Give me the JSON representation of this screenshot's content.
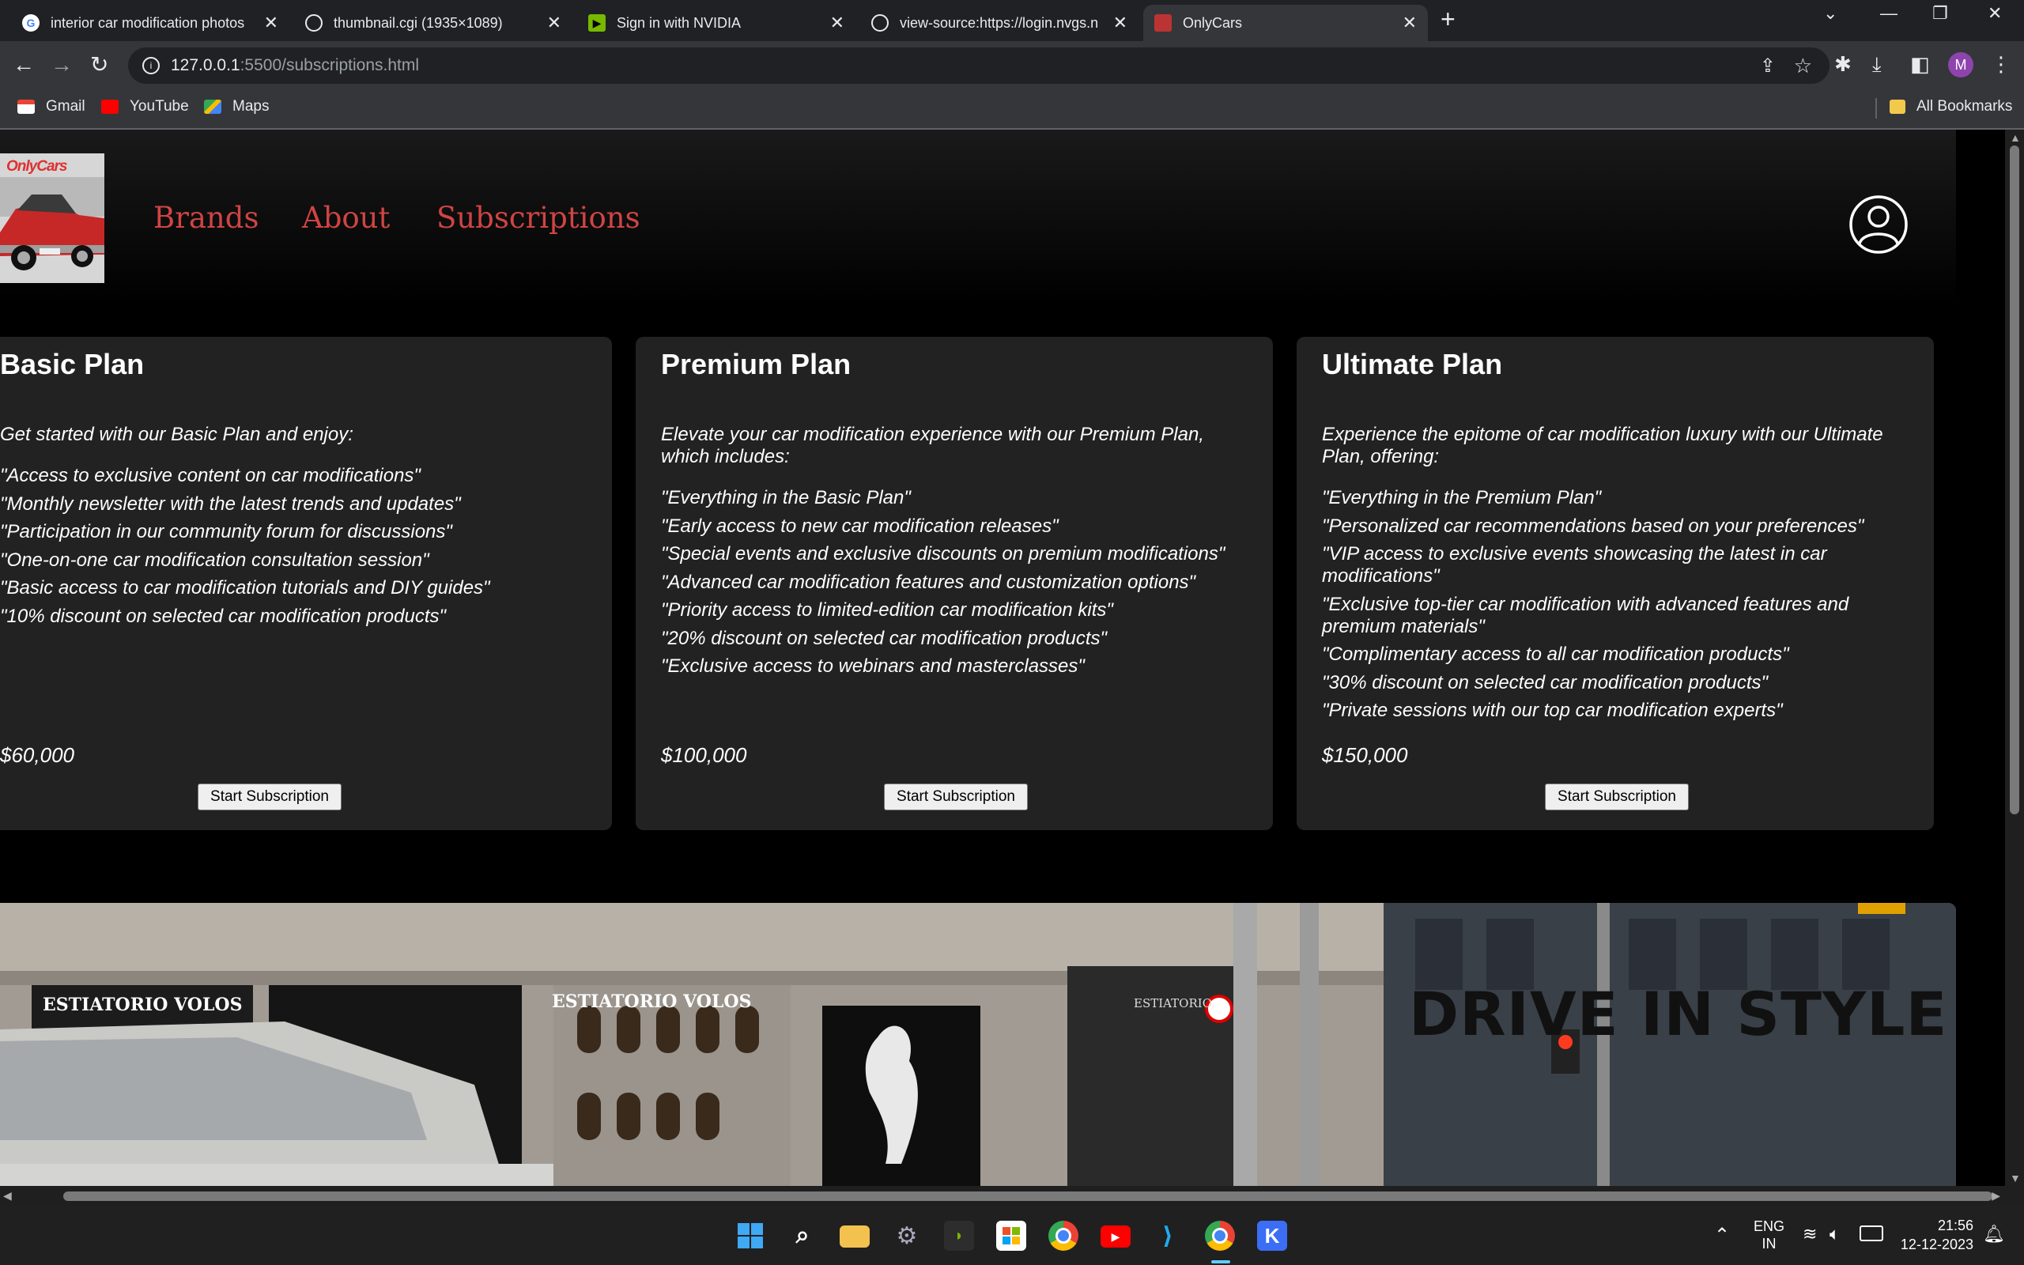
{
  "browser": {
    "tabs": [
      {
        "title": "interior car modification photos",
        "icon": "google-icon",
        "active": false
      },
      {
        "title": "thumbnail.cgi (1935×1089)",
        "icon": "globe-icon",
        "active": false
      },
      {
        "title": "Sign in with NVIDIA",
        "icon": "nvidia-icon",
        "active": false
      },
      {
        "title": "view-source:https://login.nvgs.n",
        "icon": "globe-icon",
        "active": false
      },
      {
        "title": "OnlyCars",
        "icon": "site-icon",
        "active": true
      }
    ],
    "url_host": "127.0.0.1",
    "url_path": ":5500/subscriptions.html",
    "profile_initial": "M",
    "bookmarks": [
      {
        "label": "Gmail",
        "icon": "gmail-icon"
      },
      {
        "label": "YouTube",
        "icon": "youtube-icon"
      },
      {
        "label": "Maps",
        "icon": "maps-icon"
      }
    ],
    "all_bookmarks": "All Bookmarks"
  },
  "site": {
    "logo_text": "OnlyCars",
    "nav": [
      "Brands",
      "About",
      "Subscriptions"
    ],
    "nav_color": "#d04444",
    "plans": [
      {
        "name": "Basic Plan",
        "intro": "Get started with our Basic Plan and enjoy:",
        "features": [
          "\"Access to exclusive content on car modifications\"",
          "\"Monthly newsletter with the latest trends and updates\"",
          "\"Participation in our community forum for discussions\"",
          "\"One-on-one car modification consultation session\"",
          "\"Basic access to car modification tutorials and DIY guides\"",
          "\"10% discount on selected car modification products\""
        ],
        "price": "$60,000",
        "button": "Start Subscription"
      },
      {
        "name": "Premium Plan",
        "intro": "Elevate your car modification experience with our Premium Plan, which includes:",
        "features": [
          "\"Everything in the Basic Plan\"",
          "\"Early access to new car modification releases\"",
          "\"Special events and exclusive discounts on premium modifications\"",
          "\"Advanced car modification features and customization options\"",
          "\"Priority access to limited-edition car modification kits\"",
          "\"20% discount on selected car modification products\"",
          "\"Exclusive access to webinars and masterclasses\""
        ],
        "price": "$100,000",
        "button": "Start Subscription"
      },
      {
        "name": "Ultimate Plan",
        "intro": "Experience the epitome of car modification luxury with our Ultimate Plan, offering:",
        "features": [
          "\"Everything in the Premium Plan\"",
          "\"Personalized car recommendations based on your preferences\"",
          "\"VIP access to exclusive events showcasing the latest in car modifications\"",
          "\"Exclusive top-tier car modification with advanced features and premium materials\"",
          "\"Complimentary access to all car modification products\"",
          "\"30% discount on selected car modification products\"",
          "\"Private sessions with our top car modification experts\""
        ],
        "price": "$150,000",
        "button": "Start Subscription"
      }
    ],
    "hero": {
      "title": "DRIVE IN STYLE",
      "signs": [
        "ESTIATORIO VOLOS",
        "ESTIATORIO VOLOS",
        "ESTIATORIO"
      ]
    }
  },
  "taskbar": {
    "language": "ENG",
    "region": "IN",
    "time": "21:56",
    "date": "12-12-2023"
  }
}
